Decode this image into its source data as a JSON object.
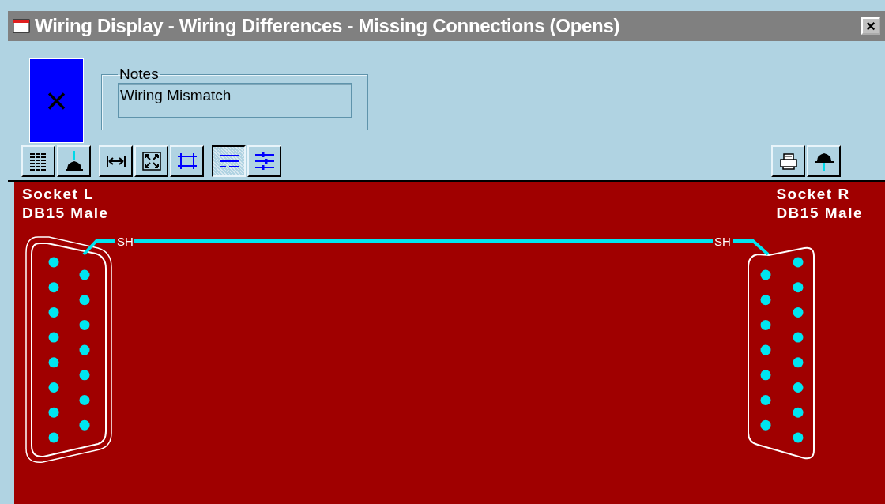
{
  "window": {
    "title": "Wiring Display - Wiring Differences - Missing Connections (Opens)",
    "close": "×"
  },
  "status": {
    "mark": "×"
  },
  "notes": {
    "label": "Notes",
    "value": "Wiring Mismatch"
  },
  "toolbar": {
    "groups": [
      {
        "buttons": [
          {
            "pressed": false
          },
          {
            "pressed": false
          }
        ]
      },
      {
        "buttons": [
          {
            "pressed": false
          },
          {
            "pressed": false
          },
          {
            "pressed": false
          }
        ]
      },
      {
        "buttons": [
          {
            "pressed": true
          },
          {
            "pressed": false
          }
        ]
      },
      {
        "buttons": [
          {
            "pressed": false
          },
          {
            "pressed": false
          }
        ]
      }
    ]
  },
  "canvas": {
    "sockets": [
      {
        "name": "Socket L",
        "type": "DB15 Male",
        "double_outline": true
      },
      {
        "name": "Socket R",
        "type": "DB15 Male",
        "double_outline": false
      }
    ],
    "wire": {
      "labels": [
        "SH",
        "SH"
      ]
    }
  }
}
